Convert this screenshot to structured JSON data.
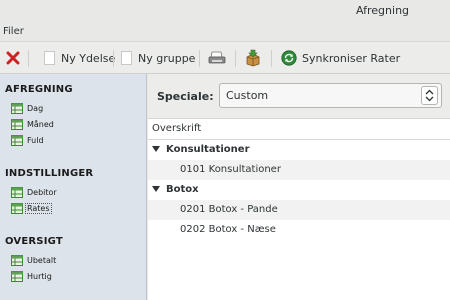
{
  "window": {
    "title": "Afregning"
  },
  "menubar": {
    "items": [
      "Filer"
    ]
  },
  "toolbar": {
    "new_service_label": "Ny Ydelse",
    "new_group_label": "Ny gruppe",
    "sync_label": "Synkroniser Rater"
  },
  "sidebar": {
    "sections": [
      {
        "title": "AFREGNING",
        "items": [
          "Dag",
          "Måned",
          "Fuld"
        ]
      },
      {
        "title": "INDSTILLINGER",
        "items": [
          "Debitor",
          "Rates"
        ]
      },
      {
        "title": "OVERSIGT",
        "items": [
          "Ubetalt",
          "Hurtig"
        ]
      }
    ],
    "selected_item": "Rates"
  },
  "main": {
    "speciale_label": "Speciale:",
    "speciale_value": "Custom",
    "column_header": "Overskrift",
    "groups": [
      {
        "label": "Konsultationer",
        "children": [
          "0101 Konsultationer"
        ]
      },
      {
        "label": "Botox",
        "children": [
          "0201 Botox - Pande",
          "0202 Botox - Næse"
        ]
      }
    ]
  },
  "colors": {
    "sidebar_bg": "#dde3ea",
    "delete_red": "#cc2222",
    "sync_green": "#2e8b3a"
  }
}
